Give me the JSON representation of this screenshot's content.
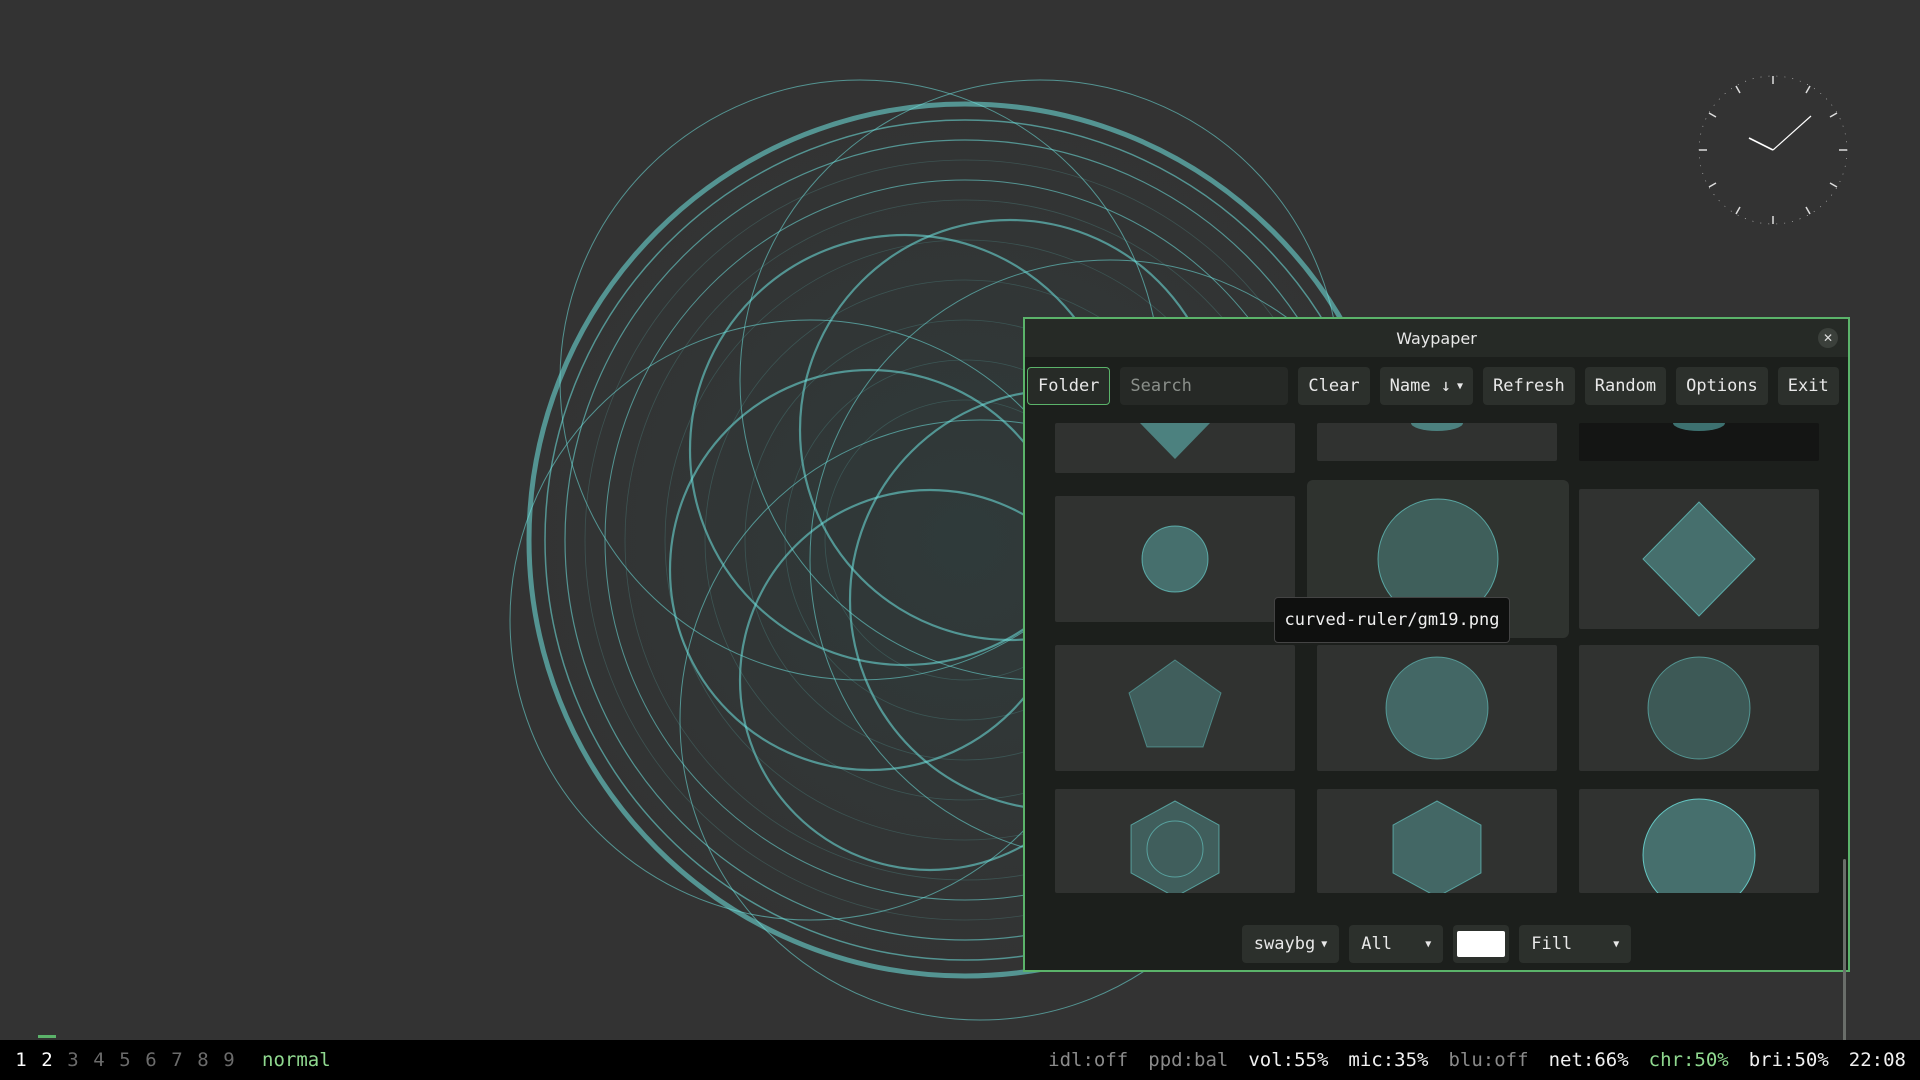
{
  "window": {
    "title": "Waypaper",
    "close": "✕",
    "toolbar": {
      "folder": "Folder",
      "search_placeholder": "Search",
      "clear": "Clear",
      "sort": "Name ↓",
      "refresh": "Refresh",
      "random": "Random",
      "options": "Options",
      "exit": "Exit"
    },
    "tooltip": "curved-ruler/gm19.png",
    "bottom": {
      "backend": "swaybg",
      "monitor": "All",
      "color": "#ffffff",
      "fill": "Fill"
    }
  },
  "statusbar": {
    "workspaces": [
      "1",
      "2",
      "3",
      "4",
      "5",
      "6",
      "7",
      "8",
      "9"
    ],
    "mode": "normal",
    "items": [
      {
        "text": "idl:off",
        "style": "dim"
      },
      {
        "text": "ppd:bal",
        "style": "dim"
      },
      {
        "text": "vol:55%",
        "style": "bright"
      },
      {
        "text": "mic:35%",
        "style": "bright"
      },
      {
        "text": "blu:off",
        "style": "dim"
      },
      {
        "text": "net:66%",
        "style": "bright"
      },
      {
        "text": "chr:50%",
        "style": "green"
      },
      {
        "text": "bri:50%",
        "style": "bright"
      },
      {
        "text": "22:08",
        "style": "bright"
      }
    ]
  },
  "colors": {
    "accent": "#5bb36a",
    "art": "#6fe3e0"
  }
}
